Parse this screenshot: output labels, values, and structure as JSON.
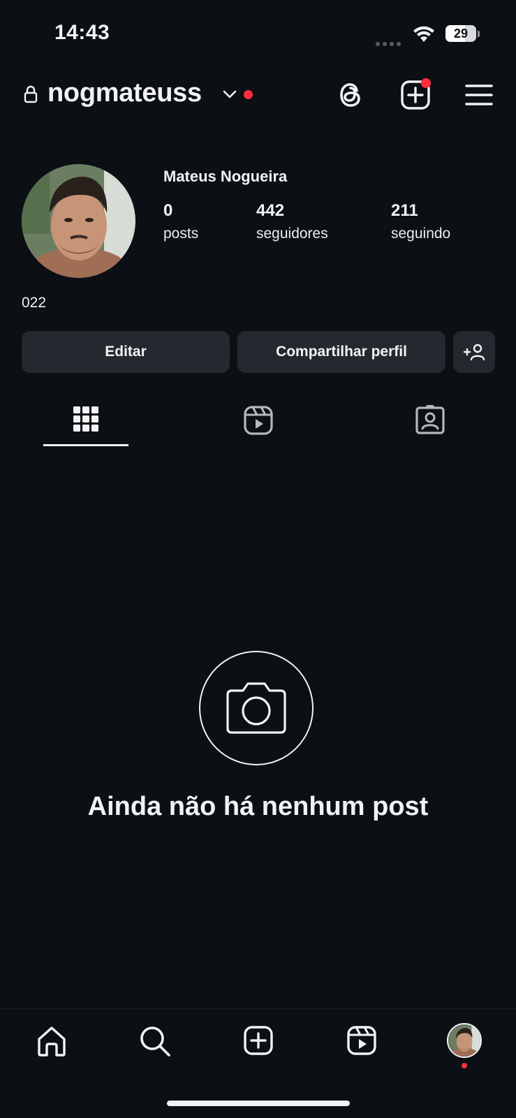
{
  "status": {
    "time": "14:43",
    "battery": "29"
  },
  "header": {
    "username": "nogmateuss"
  },
  "profile": {
    "display_name": "Mateus Nogueira",
    "stats": {
      "posts": {
        "value": "0",
        "label": "posts"
      },
      "followers": {
        "value": "442",
        "label": "seguidores"
      },
      "following": {
        "value": "211",
        "label": "seguindo"
      }
    },
    "bio": "022"
  },
  "buttons": {
    "edit": "Editar",
    "share": "Compartilhar perfil"
  },
  "tabs": [
    "grid-icon",
    "reels-icon",
    "tagged-icon"
  ],
  "empty_state": {
    "text": "Ainda não há nenhum post"
  },
  "nav": [
    "home-icon",
    "search-icon",
    "create-icon",
    "reels-icon",
    "profile-avatar"
  ],
  "colors": {
    "background": "#0c0f14",
    "button": "#25282e",
    "notification": "#ff2d3d",
    "text": "#f2f3f5"
  }
}
